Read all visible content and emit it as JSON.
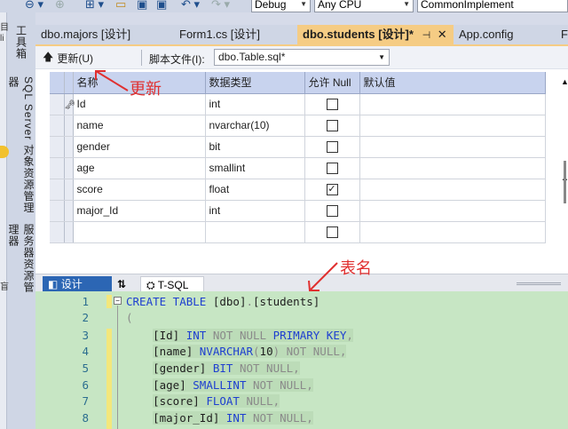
{
  "toolbar": {
    "config_combo": "Debug",
    "platform_combo": "Any CPU",
    "project_combo": "CommonImplement"
  },
  "leftstrip": {
    "tabs": [
      "工具箱",
      "SQL Server 对象资源管理器",
      "服务器资源管理器"
    ],
    "edge_chars": [
      "目",
      "li",
      "盲"
    ]
  },
  "doctabs": [
    {
      "label": "dbo.majors [设计]"
    },
    {
      "label": "Form1.cs [设计]"
    },
    {
      "label": "dbo.students [设计]*",
      "pin": "⊣",
      "close": "✕"
    },
    {
      "label": "App.config"
    },
    {
      "label": "F"
    }
  ],
  "designer": {
    "update_label": "更新(U)",
    "script_label": "脚本文件(I):",
    "script_value": "dbo.Table.sql*",
    "columns": [
      "名称",
      "数据类型",
      "允许 Null",
      "默认值"
    ],
    "rows": [
      {
        "name": "Id",
        "type": "int",
        "nullable": false,
        "key": true
      },
      {
        "name": "name",
        "type": "nvarchar(10)",
        "nullable": false,
        "key": false
      },
      {
        "name": "gender",
        "type": "bit",
        "nullable": false,
        "key": false
      },
      {
        "name": "age",
        "type": "smallint",
        "nullable": false,
        "key": false
      },
      {
        "name": "score",
        "type": "float",
        "nullable": true,
        "key": false
      },
      {
        "name": "major_Id",
        "type": "int",
        "nullable": false,
        "key": false
      },
      {
        "name": "",
        "type": "",
        "nullable": false,
        "key": false
      }
    ]
  },
  "bottom_tabs": {
    "design": "设计",
    "swap": "⇅",
    "tsql": "T-SQL"
  },
  "annotations": {
    "update": "更新",
    "table_name": "表名"
  },
  "code": {
    "line_numbers": [
      "1",
      "2",
      "3",
      "4",
      "5",
      "6",
      "7",
      "8"
    ],
    "line1": {
      "k1": "CREATE TABLE ",
      "i1": "[dbo]",
      "p": ".",
      "i2": "[students]"
    },
    "line2": "(",
    "line3": {
      "i": "[Id] ",
      "k": "INT ",
      "g": "NOT NULL ",
      "k2": "PRIMARY KEY",
      "g2": ","
    },
    "line4": {
      "i": "[name] ",
      "k": "NVARCHAR",
      "g": "(",
      "n": "10",
      "g2": ") NOT NULL,"
    },
    "line5": {
      "i": "[gender] ",
      "k": "BIT ",
      "g": "NOT NULL,"
    },
    "line6": {
      "i": "[age] ",
      "k": "SMALLINT ",
      "g": "NOT NULL,"
    },
    "line7": {
      "i": "[score] ",
      "k": "FLOAT ",
      "g": "NULL,"
    },
    "line8": {
      "i": "[major_Id] ",
      "k": "INT ",
      "g": "NOT NULL,"
    }
  },
  "colors": {
    "active_tab": "#f5cc84",
    "grid_header": "#c8d3ee",
    "editor_bg": "#c7e6c4",
    "annotation": "#e03030",
    "keyword": "#1e3fd0"
  }
}
